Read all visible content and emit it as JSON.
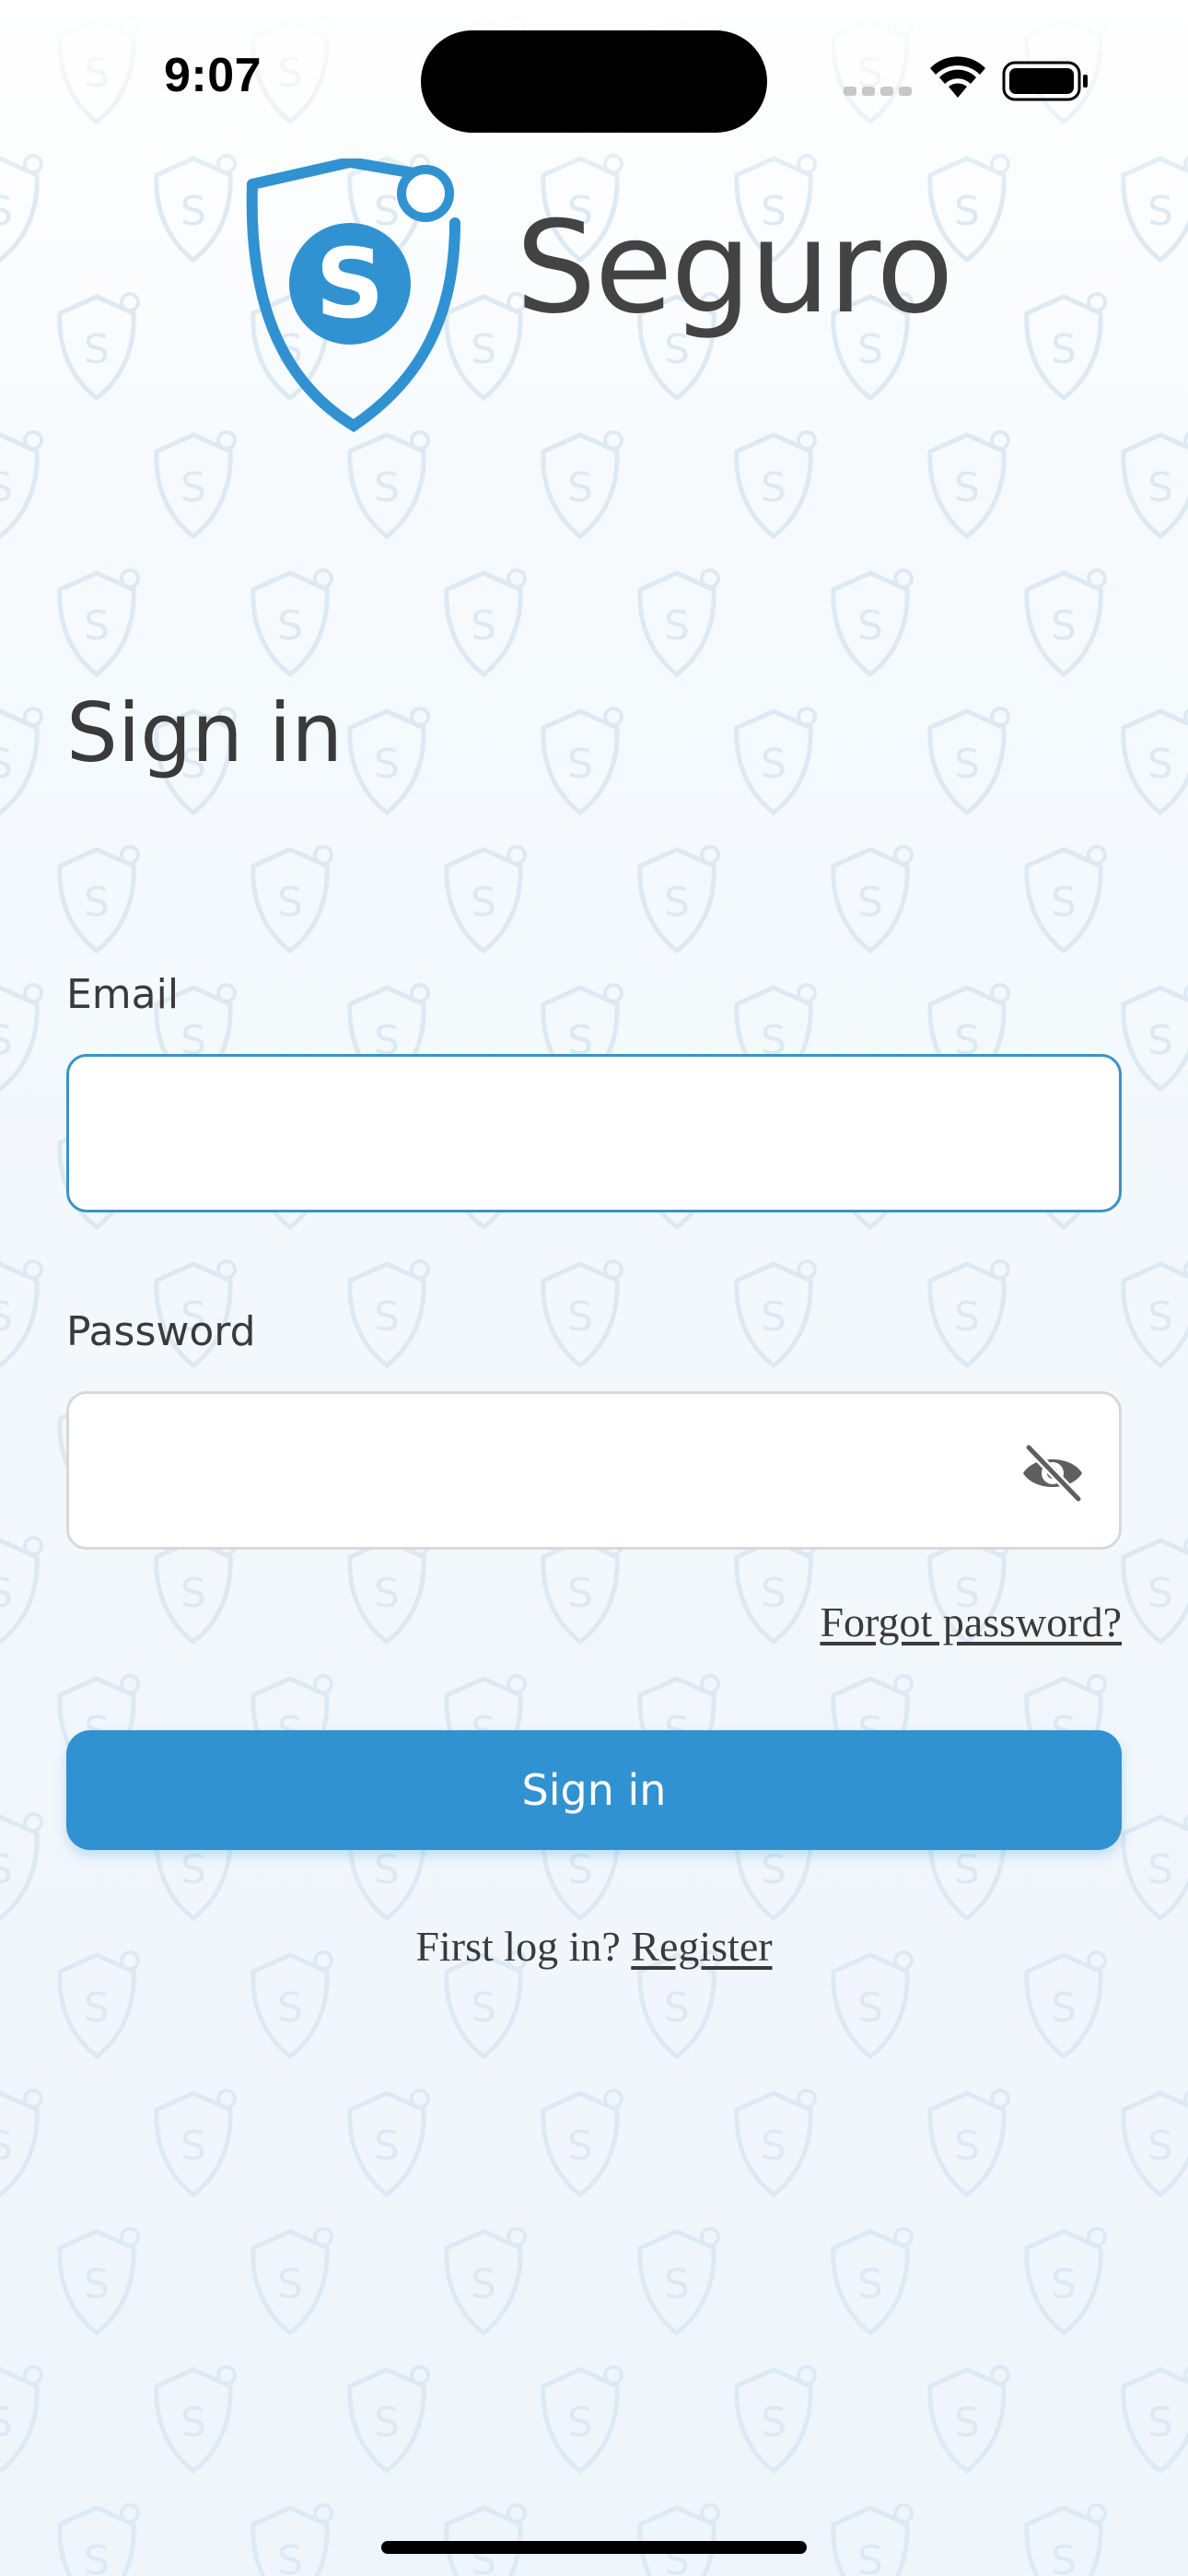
{
  "status_bar": {
    "time": "9:07"
  },
  "brand": {
    "name": "Seguro",
    "logo_letter": "S",
    "primary_color": "#3192d1",
    "text_color": "#434343"
  },
  "page": {
    "title": "Sign in"
  },
  "form": {
    "email_label": "Email",
    "email_value": "",
    "password_label": "Password",
    "password_value": "",
    "password_toggle_icon": "eye-off-icon",
    "forgot_password": "Forgot password?",
    "submit_label": "Sign in"
  },
  "register": {
    "prompt": "First log in?",
    "link_label": "Register"
  },
  "colors": {
    "focus_border": "#3b93c7",
    "idle_border": "#d9d9d9"
  }
}
